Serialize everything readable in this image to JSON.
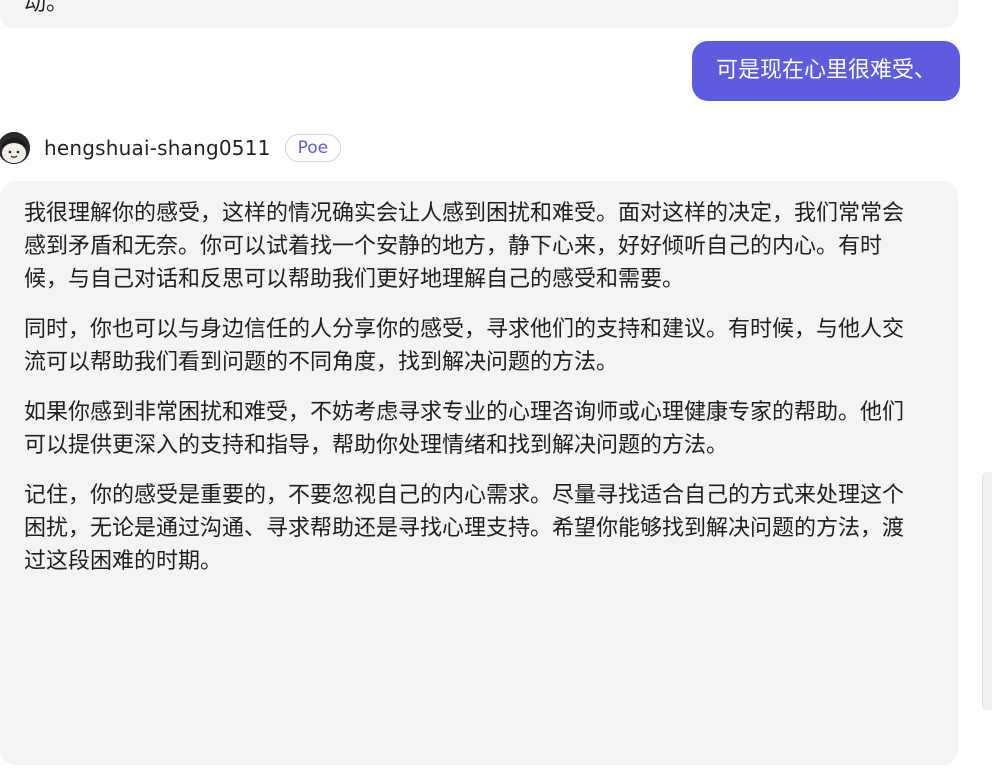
{
  "previous_message": {
    "tail_text": "动。"
  },
  "user_message": {
    "text": "可是现在心里很难受、"
  },
  "bot": {
    "name": "hengshuai-shang0511",
    "badge": "Poe",
    "avatar_icon": "cartoon-face-avatar"
  },
  "bot_message": {
    "paragraphs": [
      "我很理解你的感受，这样的情况确实会让人感到困扰和难受。面对这样的决定，我们常常会感到矛盾和无奈。你可以试着找一个安静的地方，静下心来，好好倾听自己的内心。有时候，与自己对话和反思可以帮助我们更好地理解自己的感受和需要。",
      "同时，你也可以与身边信任的人分享你的感受，寻求他们的支持和建议。有时候，与他人交流可以帮助我们看到问题的不同角度，找到解决问题的方法。",
      "如果你感到非常困扰和难受，不妨考虑寻求专业的心理咨询师或心理健康专家的帮助。他们可以提供更深入的支持和指导，帮助你处理情绪和找到解决问题的方法。",
      "记住，你的感受是重要的，不要忽视自己的内心需求。尽量寻找适合自己的方式来处理这个困扰，无论是通过沟通、寻求帮助还是寻找心理支持。希望你能够找到解决问题的方法，渡过这段困难的时期。"
    ]
  },
  "colors": {
    "user_bubble": "#5d5cde",
    "bot_bubble": "#f4f4f6",
    "badge_text": "#5d5cde"
  }
}
